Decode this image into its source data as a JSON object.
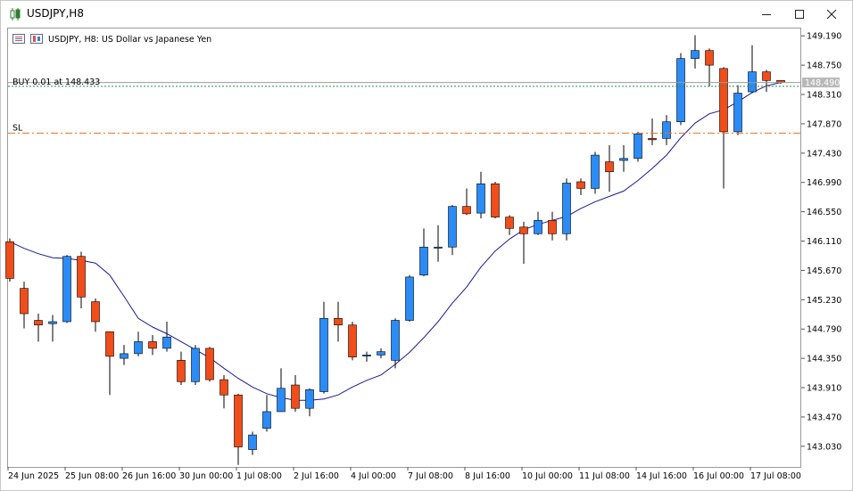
{
  "window": {
    "title": "USDJPY,H8",
    "icon": "candlestick-chart-icon",
    "controls": [
      "minimize-icon",
      "maximize-icon",
      "close-icon"
    ]
  },
  "chart_header": {
    "symbol_line": "USDJPY, H8:  US Dollar vs Japanese Yen",
    "icons": [
      "trade-panel-icon",
      "chart-mode-icon"
    ]
  },
  "colors": {
    "bull": "#2b8cf7",
    "bear": "#f04d1a",
    "ma": "#1a1a8c",
    "buy_line": "#2e8b57",
    "sl_line": "#e8702a",
    "grid": "#c8c8c8"
  },
  "trade_levels": {
    "buy_label": "BUY 0.01 at 148.433",
    "buy_price": 148.433,
    "sl_label": "SL",
    "sl_price": 147.73,
    "current_price_label": "148.490",
    "current_price": 148.49
  },
  "chart_data": {
    "type": "candlestick",
    "symbol": "USDJPY",
    "timeframe": "H8",
    "ylim": [
      142.72,
      149.3
    ],
    "y_ticks": [
      "149.190",
      "148.750",
      "148.310",
      "147.870",
      "147.430",
      "146.990",
      "146.550",
      "146.110",
      "145.670",
      "145.230",
      "144.790",
      "144.350",
      "143.910",
      "143.470",
      "143.030"
    ],
    "x_tick_labels": [
      "24 Jun 2025",
      "25 Jun 08:00",
      "26 Jun 16:00",
      "30 Jun 00:00",
      "1 Jul 08:00",
      "2 Jul 16:00",
      "4 Jul 00:00",
      "7 Jul 08:00",
      "8 Jul 16:00",
      "10 Jul 00:00",
      "11 Jul 08:00",
      "14 Jul 16:00",
      "16 Jul 00:00",
      "17 Jul 08:00"
    ],
    "x_tick_bar_index": [
      0,
      4,
      8,
      12,
      16,
      20,
      24,
      28,
      32,
      36,
      40,
      44,
      48,
      52
    ],
    "candles": [
      {
        "o": 146.1,
        "h": 146.15,
        "l": 145.5,
        "c": 145.55
      },
      {
        "o": 145.4,
        "h": 145.5,
        "l": 144.8,
        "c": 145.02
      },
      {
        "o": 144.92,
        "h": 145.02,
        "l": 144.6,
        "c": 144.85
      },
      {
        "o": 144.87,
        "h": 145.0,
        "l": 144.6,
        "c": 144.9
      },
      {
        "o": 144.9,
        "h": 145.9,
        "l": 144.88,
        "c": 145.88
      },
      {
        "o": 145.88,
        "h": 145.95,
        "l": 145.1,
        "c": 145.27
      },
      {
        "o": 145.2,
        "h": 145.25,
        "l": 144.75,
        "c": 144.9
      },
      {
        "o": 144.75,
        "h": 144.75,
        "l": 143.8,
        "c": 144.38
      },
      {
        "o": 144.35,
        "h": 144.55,
        "l": 144.25,
        "c": 144.42
      },
      {
        "o": 144.42,
        "h": 144.75,
        "l": 144.38,
        "c": 144.6
      },
      {
        "o": 144.6,
        "h": 144.7,
        "l": 144.4,
        "c": 144.5
      },
      {
        "o": 144.5,
        "h": 144.9,
        "l": 144.45,
        "c": 144.67
      },
      {
        "o": 144.32,
        "h": 144.45,
        "l": 143.95,
        "c": 144.0
      },
      {
        "o": 144.0,
        "h": 144.55,
        "l": 143.95,
        "c": 144.5
      },
      {
        "o": 144.5,
        "h": 144.52,
        "l": 144.0,
        "c": 144.03
      },
      {
        "o": 144.03,
        "h": 144.1,
        "l": 143.6,
        "c": 143.8
      },
      {
        "o": 143.8,
        "h": 143.82,
        "l": 142.75,
        "c": 143.02
      },
      {
        "o": 142.98,
        "h": 143.25,
        "l": 142.9,
        "c": 143.2
      },
      {
        "o": 143.3,
        "h": 143.8,
        "l": 143.25,
        "c": 143.55
      },
      {
        "o": 143.55,
        "h": 144.2,
        "l": 143.55,
        "c": 143.9
      },
      {
        "o": 143.95,
        "h": 144.1,
        "l": 143.55,
        "c": 143.6
      },
      {
        "o": 143.6,
        "h": 143.9,
        "l": 143.48,
        "c": 143.88
      },
      {
        "o": 143.85,
        "h": 145.2,
        "l": 143.82,
        "c": 144.95
      },
      {
        "o": 144.95,
        "h": 145.2,
        "l": 144.6,
        "c": 144.85
      },
      {
        "o": 144.85,
        "h": 144.9,
        "l": 144.32,
        "c": 144.37
      },
      {
        "o": 144.4,
        "h": 144.45,
        "l": 144.3,
        "c": 144.4
      },
      {
        "o": 144.4,
        "h": 144.5,
        "l": 144.35,
        "c": 144.45
      },
      {
        "o": 144.32,
        "h": 144.95,
        "l": 144.2,
        "c": 144.92
      },
      {
        "o": 144.92,
        "h": 145.6,
        "l": 144.9,
        "c": 145.57
      },
      {
        "o": 145.6,
        "h": 146.3,
        "l": 145.58,
        "c": 146.02
      },
      {
        "o": 146.02,
        "h": 146.35,
        "l": 145.8,
        "c": 146.02
      },
      {
        "o": 146.02,
        "h": 146.65,
        "l": 145.9,
        "c": 146.63
      },
      {
        "o": 146.63,
        "h": 146.9,
        "l": 146.5,
        "c": 146.52
      },
      {
        "o": 146.53,
        "h": 147.15,
        "l": 146.45,
        "c": 146.97
      },
      {
        "o": 146.97,
        "h": 147.0,
        "l": 146.45,
        "c": 146.47
      },
      {
        "o": 146.47,
        "h": 146.5,
        "l": 146.2,
        "c": 146.3
      },
      {
        "o": 146.32,
        "h": 146.4,
        "l": 145.77,
        "c": 146.22
      },
      {
        "o": 146.22,
        "h": 146.55,
        "l": 146.2,
        "c": 146.42
      },
      {
        "o": 146.42,
        "h": 146.55,
        "l": 146.12,
        "c": 146.22
      },
      {
        "o": 146.22,
        "h": 147.05,
        "l": 146.12,
        "c": 146.98
      },
      {
        "o": 147.0,
        "h": 147.05,
        "l": 146.8,
        "c": 146.9
      },
      {
        "o": 146.9,
        "h": 147.45,
        "l": 146.82,
        "c": 147.4
      },
      {
        "o": 147.3,
        "h": 147.55,
        "l": 146.85,
        "c": 147.15
      },
      {
        "o": 147.32,
        "h": 147.55,
        "l": 147.15,
        "c": 147.35
      },
      {
        "o": 147.35,
        "h": 147.75,
        "l": 147.3,
        "c": 147.72
      },
      {
        "o": 147.65,
        "h": 147.95,
        "l": 147.55,
        "c": 147.63
      },
      {
        "o": 147.65,
        "h": 148.0,
        "l": 147.55,
        "c": 147.9
      },
      {
        "o": 147.9,
        "h": 148.93,
        "l": 147.85,
        "c": 148.85
      },
      {
        "o": 148.85,
        "h": 149.2,
        "l": 148.7,
        "c": 148.97
      },
      {
        "o": 148.97,
        "h": 149.0,
        "l": 148.43,
        "c": 148.75
      },
      {
        "o": 148.7,
        "h": 148.72,
        "l": 146.9,
        "c": 147.75
      },
      {
        "o": 147.75,
        "h": 148.45,
        "l": 147.7,
        "c": 148.33
      },
      {
        "o": 148.35,
        "h": 149.05,
        "l": 148.33,
        "c": 148.65
      },
      {
        "o": 148.65,
        "h": 148.68,
        "l": 148.35,
        "c": 148.52
      },
      {
        "o": 148.52,
        "h": 148.52,
        "l": 148.47,
        "c": 148.49
      }
    ],
    "moving_average": [
      146.1,
      146.0,
      145.92,
      145.86,
      145.85,
      145.82,
      145.78,
      145.6,
      145.28,
      144.95,
      144.82,
      144.72,
      144.6,
      144.48,
      144.36,
      144.2,
      144.05,
      143.92,
      143.82,
      143.76,
      143.72,
      143.72,
      143.74,
      143.8,
      143.92,
      144.02,
      144.1,
      144.26,
      144.44,
      144.66,
      144.9,
      145.18,
      145.42,
      145.72,
      145.96,
      146.14,
      146.28,
      146.36,
      146.42,
      146.48,
      146.6,
      146.7,
      146.78,
      146.86,
      147.02,
      147.2,
      147.4,
      147.66,
      147.88,
      148.02,
      148.08,
      148.2,
      148.34,
      148.44,
      148.49
    ]
  }
}
